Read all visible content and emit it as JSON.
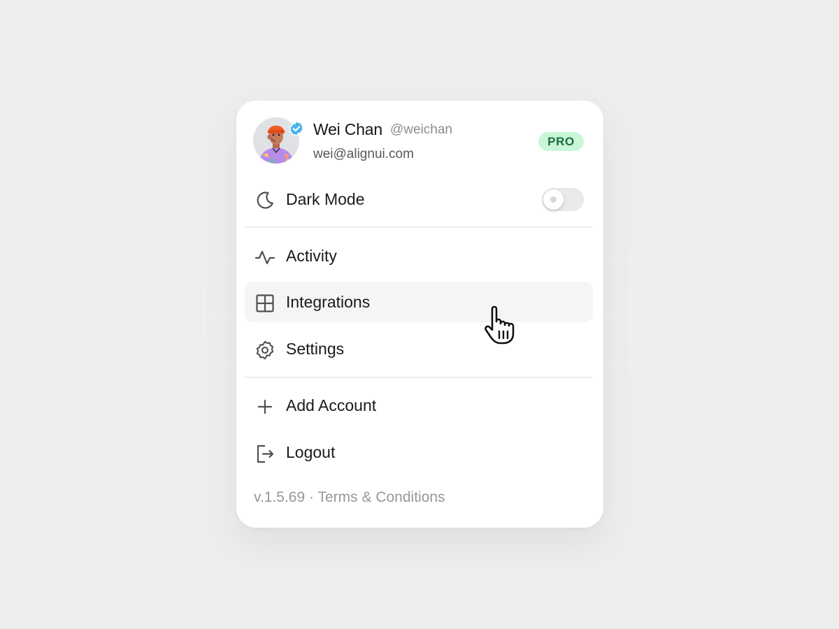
{
  "user": {
    "name": "Wei Chan",
    "handle": "@weichan",
    "email": "wei@alignui.com",
    "badge": "PRO",
    "verified": true
  },
  "dark_mode": {
    "label": "Dark Mode",
    "icon": "moon-icon",
    "enabled": false
  },
  "menu": {
    "activity": {
      "label": "Activity",
      "icon": "activity-icon"
    },
    "integrations": {
      "label": "Integrations",
      "icon": "grid-icon",
      "hovered": true
    },
    "settings": {
      "label": "Settings",
      "icon": "gear-icon"
    },
    "add_account": {
      "label": "Add Account",
      "icon": "plus-icon"
    },
    "logout": {
      "label": "Logout",
      "icon": "logout-icon"
    }
  },
  "footer": {
    "version": "v.1.5.69",
    "separator": "·",
    "terms": "Terms & Conditions"
  },
  "colors": {
    "badge_bg": "#c9f6d7",
    "badge_text": "#1e6b3a",
    "verified": "#47b4ec",
    "hover_bg": "#f4f5f4"
  }
}
